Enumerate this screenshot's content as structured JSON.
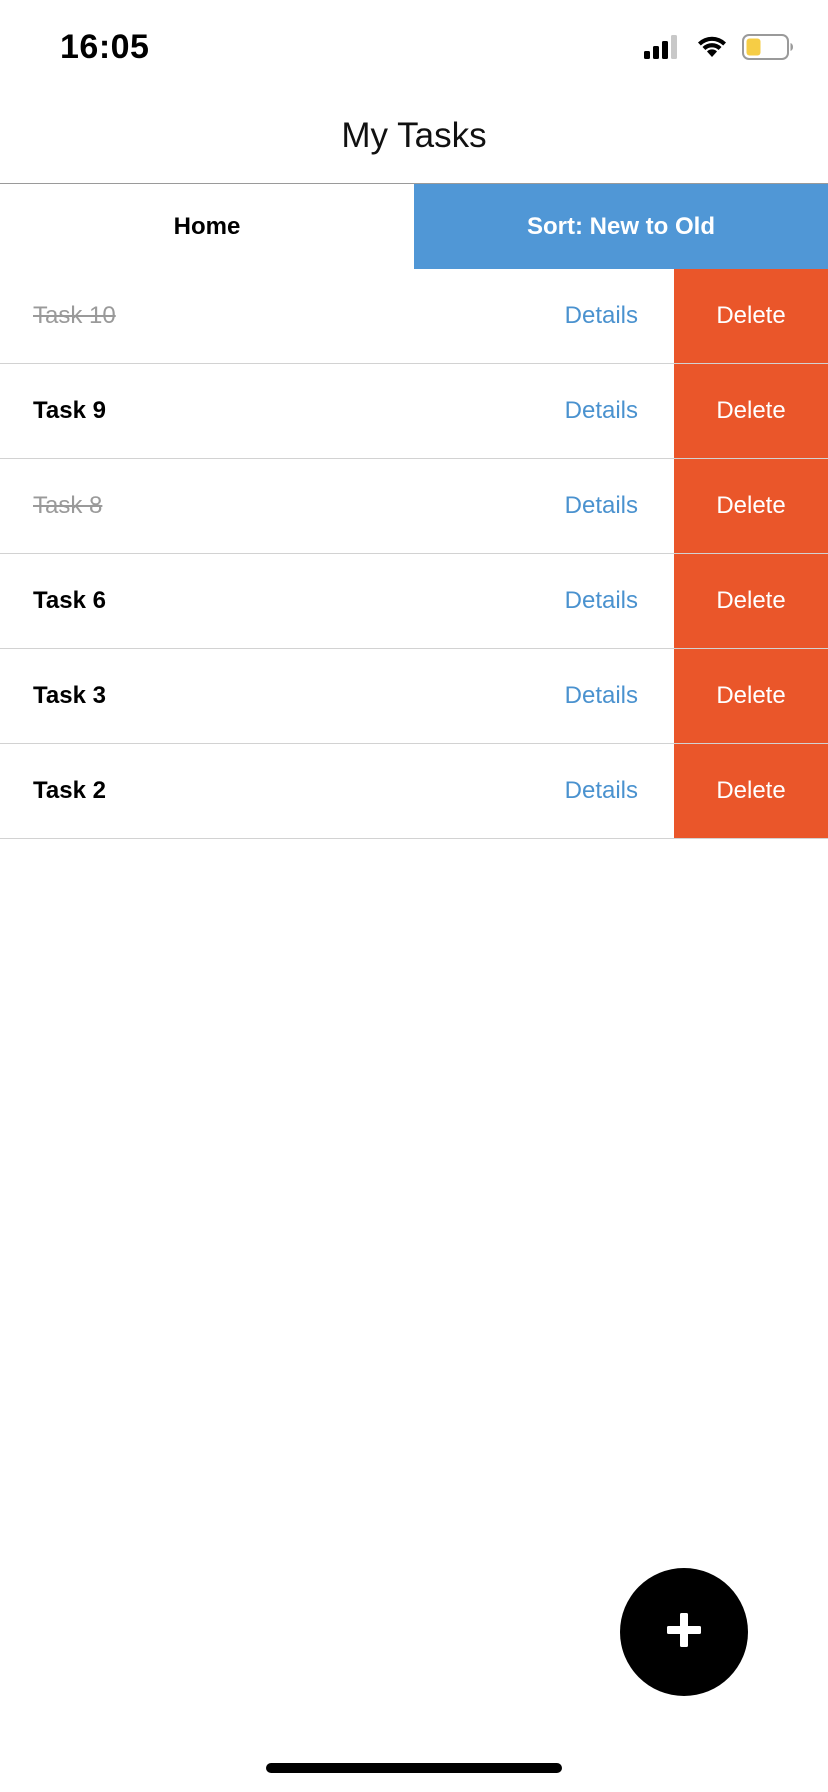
{
  "status_bar": {
    "time": "16:05",
    "icons": [
      "cellular-signal-icon",
      "wifi-icon",
      "battery-icon"
    ],
    "battery_level": 0.3,
    "battery_color": "#f6cd45"
  },
  "header": {
    "title": "My Tasks"
  },
  "tabs": {
    "home_label": "Home",
    "sort_label": "Sort: New to Old",
    "active_color": "#5097d6"
  },
  "tasks": [
    {
      "name": "Task 10",
      "completed": true,
      "details_label": "Details",
      "delete_label": "Delete"
    },
    {
      "name": "Task 9",
      "completed": false,
      "details_label": "Details",
      "delete_label": "Delete"
    },
    {
      "name": "Task 8",
      "completed": true,
      "details_label": "Details",
      "delete_label": "Delete"
    },
    {
      "name": "Task 6",
      "completed": false,
      "details_label": "Details",
      "delete_label": "Delete"
    },
    {
      "name": "Task 3",
      "completed": false,
      "details_label": "Details",
      "delete_label": "Delete"
    },
    {
      "name": "Task 2",
      "completed": false,
      "details_label": "Details",
      "delete_label": "Delete"
    }
  ],
  "colors": {
    "delete": "#ea562a",
    "details_link": "#4a92cf"
  },
  "fab": {
    "icon": "plus-icon"
  }
}
